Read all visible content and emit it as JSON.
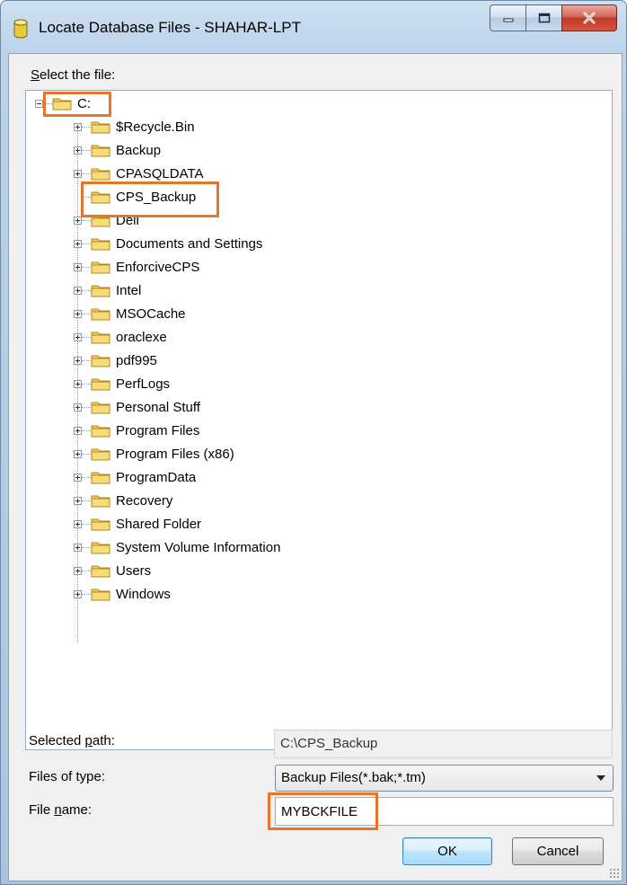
{
  "window": {
    "title": "Locate Database Files - SHAHAR-LPT"
  },
  "dialog": {
    "select_label": "Select the file:",
    "tree": {
      "root": "C:",
      "items": [
        "$Recycle.Bin",
        "Backup",
        "CPASQLDATA",
        "CPS_Backup",
        "Dell",
        "Documents and Settings",
        "EnforciveCPS",
        "Intel",
        "MSOCache",
        "oraclexe",
        "pdf995",
        "PerfLogs",
        "Personal Stuff",
        "Program Files",
        "Program Files (x86)",
        "ProgramData",
        "Recovery",
        "Shared Folder",
        "System Volume Information",
        "Users",
        "Windows"
      ]
    },
    "selected_path_label": "Selected path:",
    "selected_path_value": "C:\\CPS_Backup",
    "files_of_type_label": "Files of type:",
    "files_of_type_value": "Backup Files(*.bak;*.tm)",
    "file_name_label": "File name:",
    "file_name_value": "MYBCKFILE",
    "ok_label": "OK",
    "cancel_label": "Cancel"
  },
  "colors": {
    "highlight": "#e8742a",
    "folder": "#f3cc5a"
  }
}
